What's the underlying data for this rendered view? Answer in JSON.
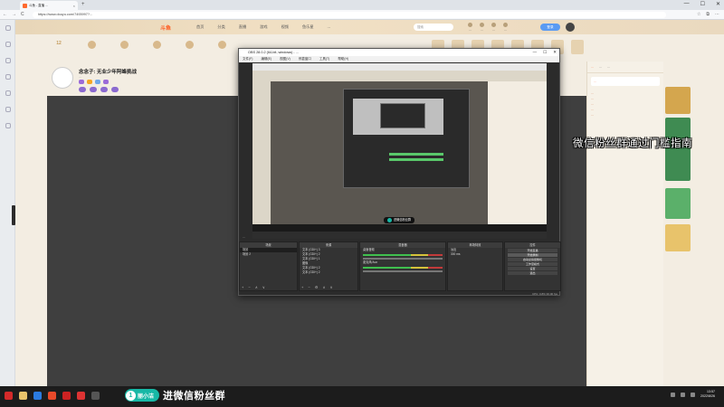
{
  "browser": {
    "tab_title": "斗鱼 - 直播 ...",
    "tab_close": "×",
    "new_tab": "+",
    "url": "https://www.douyu.com/7493997?...",
    "win_min": "—",
    "win_max": "☐",
    "win_close": "✕",
    "nav_back": "←",
    "nav_forward": "→",
    "nav_reload": "C"
  },
  "page": {
    "logo": "斗鱼",
    "nav": [
      "首页",
      "分类",
      "直播",
      "游戏",
      "视频",
      "鱼乐星",
      "..."
    ],
    "search_placeholder": "搜索",
    "user_links": [
      "...",
      "...",
      "...",
      "..."
    ],
    "login_label": "登录",
    "feature_first_value": "12",
    "streamer_name": "念念子: 无业少年阿峰挑战",
    "streamer_meta": "...",
    "chat_tabs": [
      "...",
      "...",
      "..."
    ],
    "chat_notice": "...",
    "chat_msgs": [
      "...",
      "...",
      "...",
      "...",
      "..."
    ]
  },
  "obs": {
    "title": "OBS 28.0.2 (64-bit, windows) - ...",
    "menu": [
      "文件(F)",
      "编辑(E)",
      "视图(V)",
      "停靠窗口",
      "工具(T)",
      "帮助(H)"
    ],
    "preview_badge": "进微信粉丝群",
    "status_line": "...",
    "docks": {
      "scenes": "场景",
      "sources": "来源",
      "mixer": "混音器",
      "transitions": "转场特效",
      "controls": "控件"
    },
    "scene_items": [
      "场景",
      "场景 2"
    ],
    "source_items": [
      "文本 (GDI+) 3",
      "文本 (GDI+) 2",
      "文本 (GDI+) 1",
      "图像",
      "文本 (GDI+) 2",
      "文本 (GDI+) 2"
    ],
    "mixer_channels": [
      "桌面音频",
      "麦克风/Aux"
    ],
    "transition_type": "淡出",
    "transition_duration": "300 ms",
    "control_buttons": [
      "开始直播",
      "开始录制",
      "启动虚拟摄像机",
      "工作室模式",
      "设置",
      "退出"
    ],
    "bottom_status": "CPU: 0.8% 30.00 fps"
  },
  "overlay": {
    "title": "微信粉丝群通过门槛指南",
    "badge_number": "1",
    "badge_name": "丽小洁",
    "badge_text": "进微信粉丝群"
  },
  "taskbar": {
    "time": "13:57",
    "date": "2022/8/26"
  },
  "colors": {
    "accent_teal": "#17b8a6",
    "douyu_orange": "#ff6a2f",
    "obs_dark": "#2b2b2b"
  }
}
